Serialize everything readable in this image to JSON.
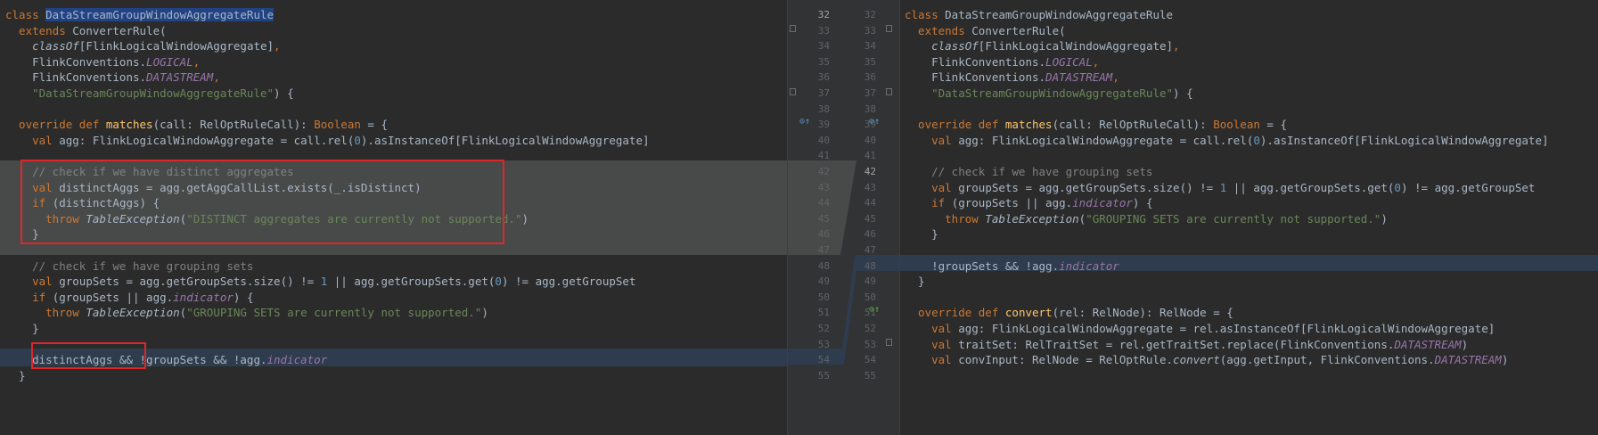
{
  "gutter_numbers": {
    "left": [
      {
        "n": "32",
        "cur": true
      },
      {
        "n": "33"
      },
      {
        "n": "34"
      },
      {
        "n": "35"
      },
      {
        "n": "36"
      },
      {
        "n": "37"
      },
      {
        "n": "38"
      },
      {
        "n": "39"
      },
      {
        "n": "40"
      },
      {
        "n": "41"
      },
      {
        "n": "42"
      },
      {
        "n": "43"
      },
      {
        "n": "44"
      },
      {
        "n": "45"
      },
      {
        "n": "46"
      },
      {
        "n": "47"
      },
      {
        "n": "48"
      },
      {
        "n": "49"
      },
      {
        "n": "50"
      },
      {
        "n": "51"
      },
      {
        "n": "52"
      },
      {
        "n": "53"
      },
      {
        "n": "54"
      },
      {
        "n": "55"
      }
    ],
    "right": [
      {
        "n": "32"
      },
      {
        "n": "33"
      },
      {
        "n": "34"
      },
      {
        "n": "35"
      },
      {
        "n": "36"
      },
      {
        "n": "37"
      },
      {
        "n": "38"
      },
      {
        "n": "39"
      },
      {
        "n": "40"
      },
      {
        "n": "41"
      },
      {
        "n": "42",
        "cur": true
      },
      {
        "n": "43"
      },
      {
        "n": "44"
      },
      {
        "n": "45"
      },
      {
        "n": "46"
      },
      {
        "n": "47"
      },
      {
        "n": "48"
      },
      {
        "n": "49"
      },
      {
        "n": "50"
      },
      {
        "n": "51"
      },
      {
        "n": "52"
      },
      {
        "n": "53"
      },
      {
        "n": "54"
      },
      {
        "n": "55"
      }
    ]
  },
  "left_code": [
    [
      [
        "kw",
        "class "
      ],
      [
        "sel",
        "DataStreamGroupWindowAggregateRule"
      ]
    ],
    [
      [
        "kw",
        "  extends "
      ],
      [
        "",
        "ConverterRule("
      ]
    ],
    [
      [
        "",
        "    "
      ],
      [
        "it",
        "classOf"
      ],
      [
        "",
        "[FlinkLogicalWindowAggregate]"
      ],
      [
        "kw",
        ","
      ]
    ],
    [
      [
        "",
        "    FlinkConventions."
      ],
      [
        "fld",
        "LOGICAL"
      ],
      [
        "kw",
        ","
      ]
    ],
    [
      [
        "",
        "    FlinkConventions."
      ],
      [
        "fld",
        "DATASTREAM"
      ],
      [
        "kw",
        ","
      ]
    ],
    [
      [
        "str",
        "    \"DataStreamGroupWindowAggregateRule\""
      ],
      [
        "",
        ") {"
      ]
    ],
    [
      [
        "",
        ""
      ]
    ],
    [
      [
        "kw",
        "  override def "
      ],
      [
        "fn",
        "matches"
      ],
      [
        "",
        "(call: RelOptRuleCall): "
      ],
      [
        "kw",
        "Boolean "
      ],
      [
        "",
        "= {"
      ]
    ],
    [
      [
        "kw",
        "    val "
      ],
      [
        "",
        "agg: FlinkLogicalWindowAggregate = call.rel("
      ],
      [
        "num",
        "0"
      ],
      [
        "",
        ").asInstanceOf[FlinkLogicalWindowAggregate]"
      ]
    ],
    [
      [
        "",
        ""
      ]
    ],
    [
      [
        "cm",
        "    // check if we have distinct aggregates"
      ]
    ],
    [
      [
        "kw",
        "    val "
      ],
      [
        "",
        "distinctAggs = agg.getAggCallList.exists(_.isDistinct)"
      ]
    ],
    [
      [
        "kw",
        "    if "
      ],
      [
        "",
        "(distinctAggs) {"
      ]
    ],
    [
      [
        "kw",
        "      throw "
      ],
      [
        "it",
        "TableException"
      ],
      [
        "",
        "("
      ],
      [
        "str",
        "\"DISTINCT aggregates are currently not supported.\""
      ],
      [
        "",
        ")"
      ]
    ],
    [
      [
        "",
        "    }"
      ]
    ],
    [
      [
        "",
        ""
      ]
    ],
    [
      [
        "cm",
        "    // check if we have grouping sets"
      ]
    ],
    [
      [
        "kw",
        "    val "
      ],
      [
        "",
        "groupSets = agg.getGroupSets.size() != "
      ],
      [
        "num",
        "1"
      ],
      [
        "",
        " || agg.getGroupSets.get("
      ],
      [
        "num",
        "0"
      ],
      [
        "",
        ") != agg.getGroupSet"
      ]
    ],
    [
      [
        "kw",
        "    if "
      ],
      [
        "",
        "(groupSets || agg."
      ],
      [
        "fld",
        "indicator"
      ],
      [
        "",
        ") {"
      ]
    ],
    [
      [
        "kw",
        "      throw "
      ],
      [
        "it",
        "TableException"
      ],
      [
        "",
        "("
      ],
      [
        "str",
        "\"GROUPING SETS are currently not supported.\""
      ],
      [
        "",
        ")"
      ]
    ],
    [
      [
        "",
        "    }"
      ]
    ],
    [
      [
        "",
        ""
      ]
    ],
    [
      [
        "",
        "    distinctAggs && !groupSets && !agg."
      ],
      [
        "fld",
        "indicator"
      ]
    ],
    [
      [
        "",
        "  }"
      ]
    ]
  ],
  "right_code": [
    [
      [
        "kw",
        "class "
      ],
      [
        "",
        "DataStreamGroupWindowAggregateRule"
      ]
    ],
    [
      [
        "kw",
        "  extends "
      ],
      [
        "",
        "ConverterRule("
      ]
    ],
    [
      [
        "",
        "    "
      ],
      [
        "it",
        "classOf"
      ],
      [
        "",
        "[FlinkLogicalWindowAggregate]"
      ],
      [
        "kw",
        ","
      ]
    ],
    [
      [
        "",
        "    FlinkConventions."
      ],
      [
        "fld",
        "LOGICAL"
      ],
      [
        "kw",
        ","
      ]
    ],
    [
      [
        "",
        "    FlinkConventions."
      ],
      [
        "fld",
        "DATASTREAM"
      ],
      [
        "kw",
        ","
      ]
    ],
    [
      [
        "str",
        "    \"DataStreamGroupWindowAggregateRule\""
      ],
      [
        "",
        ") {"
      ]
    ],
    [
      [
        "",
        ""
      ]
    ],
    [
      [
        "kw",
        "  override def "
      ],
      [
        "fn",
        "matches"
      ],
      [
        "",
        "(call: RelOptRuleCall): "
      ],
      [
        "kw",
        "Boolean "
      ],
      [
        "",
        "= {"
      ]
    ],
    [
      [
        "kw",
        "    val "
      ],
      [
        "",
        "agg: FlinkLogicalWindowAggregate = call.rel("
      ],
      [
        "num",
        "0"
      ],
      [
        "",
        ").asInstanceOf[FlinkLogicalWindowAggregate]"
      ]
    ],
    [
      [
        "",
        ""
      ]
    ],
    [
      [
        "cm",
        "    // check if we have grouping sets"
      ]
    ],
    [
      [
        "kw",
        "    val "
      ],
      [
        "",
        "groupSets = agg.getGroupSets.size() != "
      ],
      [
        "num",
        "1"
      ],
      [
        "",
        " || agg.getGroupSets.get("
      ],
      [
        "num",
        "0"
      ],
      [
        "",
        ") != agg.getGroupSet"
      ]
    ],
    [
      [
        "kw",
        "    if "
      ],
      [
        "",
        "(groupSets || agg."
      ],
      [
        "fld",
        "indicator"
      ],
      [
        "",
        ") {"
      ]
    ],
    [
      [
        "kw",
        "      throw "
      ],
      [
        "it",
        "TableException"
      ],
      [
        "",
        "("
      ],
      [
        "str",
        "\"GROUPING SETS are currently not supported.\""
      ],
      [
        "",
        ")"
      ]
    ],
    [
      [
        "",
        "    }"
      ]
    ],
    [
      [
        "",
        ""
      ]
    ],
    [
      [
        "",
        "    !groupSets && !agg."
      ],
      [
        "fld",
        "indicator"
      ]
    ],
    [
      [
        "",
        "  }"
      ]
    ],
    [
      [
        "",
        ""
      ]
    ],
    [
      [
        "kw",
        "  override def "
      ],
      [
        "fn",
        "convert"
      ],
      [
        "",
        "(rel: RelNode): RelNode = {"
      ]
    ],
    [
      [
        "kw",
        "    val "
      ],
      [
        "",
        "agg: FlinkLogicalWindowAggregate = rel.asInstanceOf[FlinkLogicalWindowAggregate]"
      ]
    ],
    [
      [
        "kw",
        "    val "
      ],
      [
        "",
        "traitSet: RelTraitSet = rel.getTraitSet.replace(FlinkConventions."
      ],
      [
        "fld",
        "DATASTREAM"
      ],
      [
        "",
        ")"
      ]
    ],
    [
      [
        "kw",
        "    val "
      ],
      [
        "",
        "convInput: RelNode = RelOptRule."
      ],
      [
        "it",
        "convert"
      ],
      [
        "",
        "(agg.getInput, FlinkConventions."
      ],
      [
        "fld",
        "DATASTREAM"
      ],
      [
        "",
        ")"
      ]
    ],
    [
      [
        "",
        ""
      ]
    ]
  ]
}
